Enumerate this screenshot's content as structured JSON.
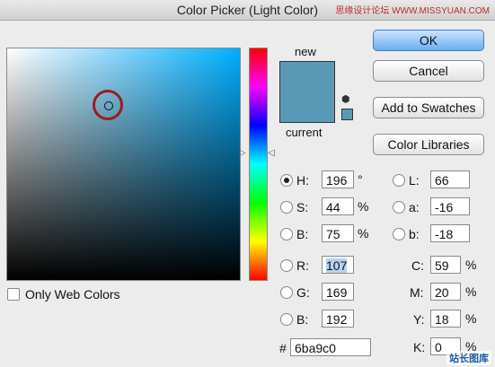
{
  "window": {
    "title": "Color Picker (Light Color)",
    "watermark_top": "思缘设计论坛 WWW.MISSYUAN.COM",
    "watermark_bottom": "站长图库"
  },
  "preview": {
    "new_label": "new",
    "current_label": "current",
    "new_color": "#5b9ab4",
    "current_color": "#5b9ab4"
  },
  "buttons": {
    "ok": "OK",
    "cancel": "Cancel",
    "add_to_swatches": "Add to Swatches",
    "color_libraries": "Color Libraries"
  },
  "only_web_colors": {
    "label": "Only Web Colors",
    "checked": false
  },
  "hsb": {
    "h": {
      "label": "H:",
      "value": "196",
      "unit": "°",
      "selected": true
    },
    "s": {
      "label": "S:",
      "value": "44",
      "unit": "%"
    },
    "b": {
      "label": "B:",
      "value": "75",
      "unit": "%"
    }
  },
  "rgb": {
    "r": {
      "label": "R:",
      "value": "107"
    },
    "g": {
      "label": "G:",
      "value": "169"
    },
    "b": {
      "label": "B:",
      "value": "192"
    }
  },
  "lab": {
    "l": {
      "label": "L:",
      "value": "66"
    },
    "a": {
      "label": "a:",
      "value": "-16"
    },
    "b": {
      "label": "b:",
      "value": "-18"
    }
  },
  "cmyk": {
    "c": {
      "label": "C:",
      "value": "59",
      "unit": "%"
    },
    "m": {
      "label": "M:",
      "value": "20",
      "unit": "%"
    },
    "y": {
      "label": "Y:",
      "value": "18",
      "unit": "%"
    },
    "k": {
      "label": "K:",
      "value": "0",
      "unit": "%"
    }
  },
  "hex": {
    "label": "#",
    "value": "6ba9c0"
  },
  "icons": {
    "cube": "cube-icon",
    "websafe": "websafe-swatch-icon"
  }
}
